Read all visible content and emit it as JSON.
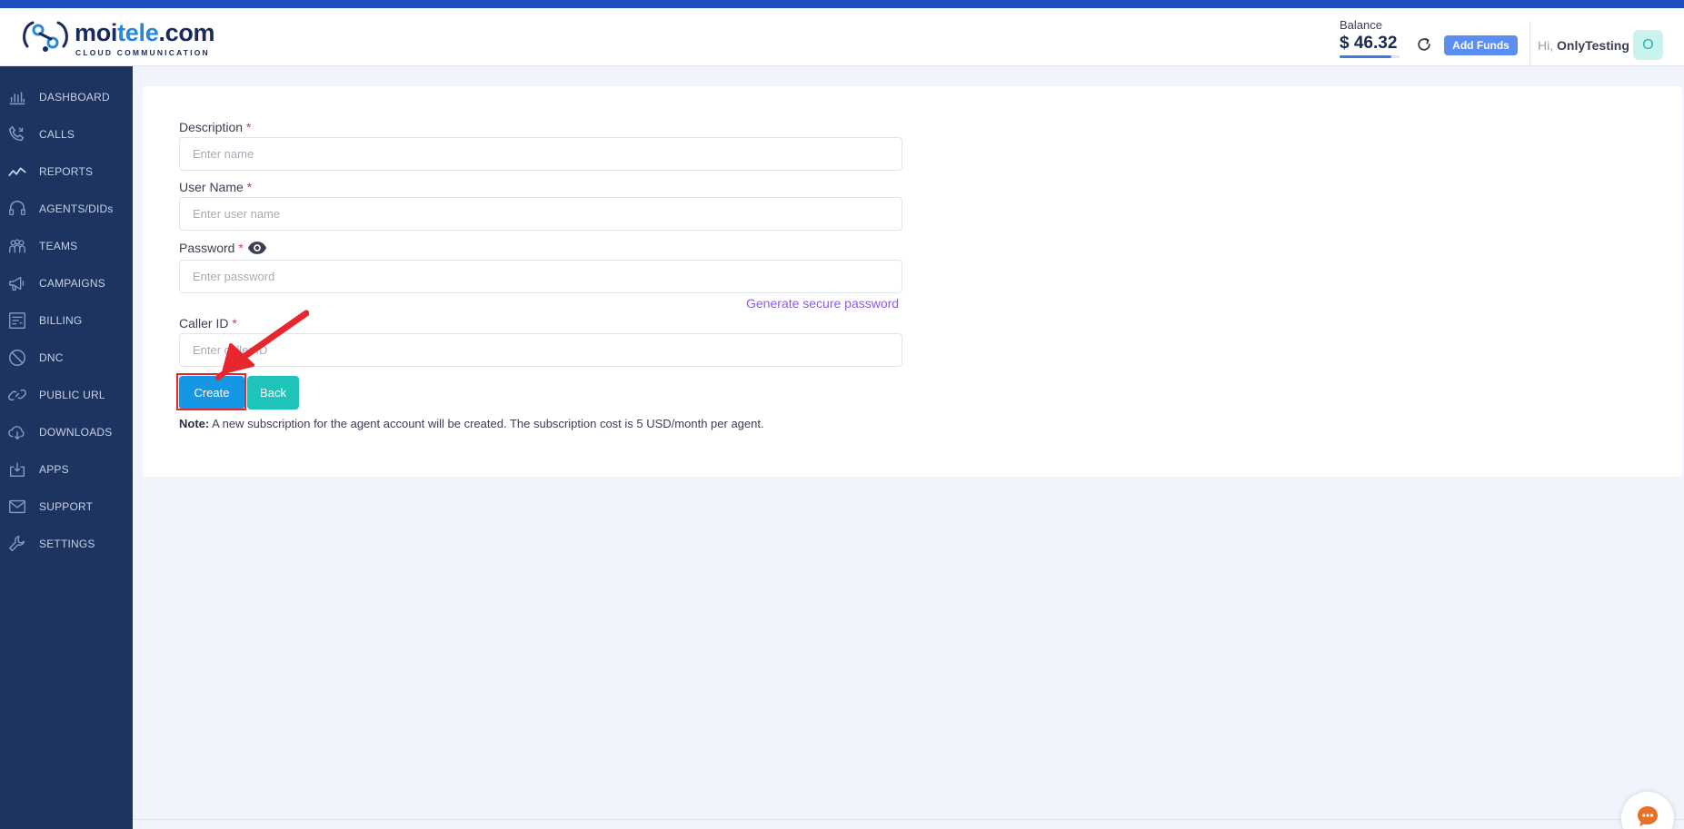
{
  "header": {
    "logo_text_a": "moi",
    "logo_text_b": "tele",
    "logo_text_c": ".com",
    "logo_sub": "CLOUD COMMUNICATION",
    "balance_label": "Balance",
    "balance_amount": "$ 46.32",
    "add_funds_label": "Add Funds",
    "greeting": "Hi,",
    "username": "OnlyTesting",
    "avatar_letter": "O"
  },
  "sidebar": {
    "items": [
      {
        "label": "DASHBOARD",
        "icon": "dashboard-icon"
      },
      {
        "label": "CALLS",
        "icon": "calls-icon"
      },
      {
        "label": "REPORTS",
        "icon": "reports-icon"
      },
      {
        "label": "AGENTS/DIDs",
        "icon": "headset-icon"
      },
      {
        "label": "TEAMS",
        "icon": "teams-icon"
      },
      {
        "label": "CAMPAIGNS",
        "icon": "megaphone-icon"
      },
      {
        "label": "BILLING",
        "icon": "billing-icon"
      },
      {
        "label": "DNC",
        "icon": "block-icon"
      },
      {
        "label": "PUBLIC URL",
        "icon": "link-icon"
      },
      {
        "label": "DOWNLOADS",
        "icon": "cloud-download-icon"
      },
      {
        "label": "APPS",
        "icon": "apps-download-icon"
      },
      {
        "label": "SUPPORT",
        "icon": "mail-icon"
      },
      {
        "label": "SETTINGS",
        "icon": "wrench-icon"
      }
    ]
  },
  "form": {
    "description_label": "Description",
    "description_placeholder": "Enter name",
    "username_label": "User Name",
    "username_placeholder": "Enter user name",
    "password_label": "Password",
    "password_placeholder": "Enter password",
    "generate_link": "Generate secure password",
    "callerid_label": "Caller ID",
    "callerid_placeholder": "Enter caller ID",
    "required_mark": "*",
    "create_label": "Create",
    "back_label": "Back",
    "note_bold": "Note:",
    "note_text": " A new subscription for the agent account will be created. The subscription cost is 5 USD/month per agent."
  },
  "colors": {
    "sidebar_bg": "#1d3461",
    "primary": "#1597e5",
    "teal": "#1ec4b9",
    "link": "#8b5ce7",
    "annotation_red": "#e8262d"
  }
}
